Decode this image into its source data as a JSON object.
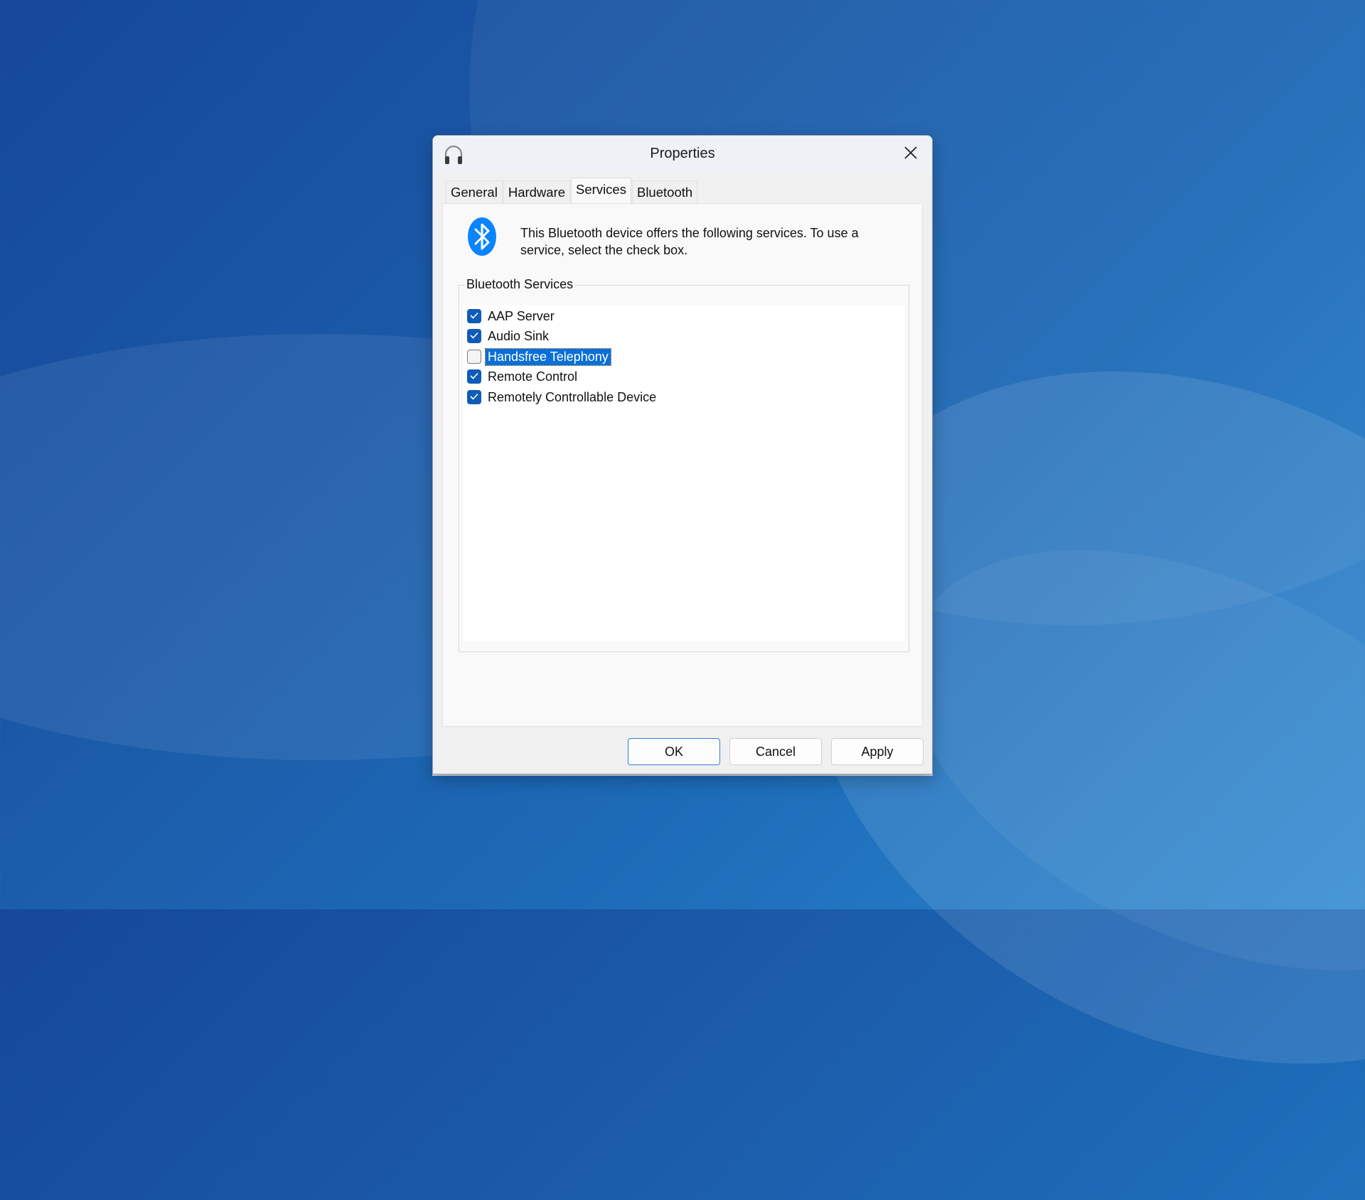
{
  "window": {
    "title": "Properties",
    "app_icon": "headphones-icon",
    "close_icon": "close-icon"
  },
  "tabs": [
    {
      "label": "General",
      "selected": false
    },
    {
      "label": "Hardware",
      "selected": false
    },
    {
      "label": "Services",
      "selected": true
    },
    {
      "label": "Bluetooth",
      "selected": false
    }
  ],
  "services_tab": {
    "icon": "bluetooth-icon",
    "description": "This Bluetooth device offers the following services. To use a service, select the check box.",
    "group_label": "Bluetooth Services",
    "services": [
      {
        "label": "AAP Server",
        "checked": true,
        "selected": false
      },
      {
        "label": "Audio Sink",
        "checked": true,
        "selected": false
      },
      {
        "label": "Handsfree Telephony",
        "checked": false,
        "selected": true
      },
      {
        "label": "Remote Control",
        "checked": true,
        "selected": false
      },
      {
        "label": "Remotely Controllable Device",
        "checked": true,
        "selected": false
      }
    ]
  },
  "buttons": {
    "ok": "OK",
    "cancel": "Cancel",
    "apply": "Apply"
  },
  "colors": {
    "accent": "#0f5cb8",
    "selection": "#0b6fd6",
    "bluetooth_brand": "#0a84ff"
  }
}
